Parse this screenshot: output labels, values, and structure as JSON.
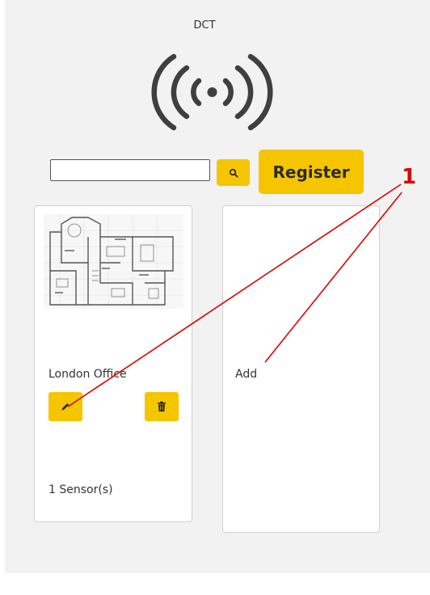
{
  "app": {
    "title": "DCT",
    "logo_icon": "wireless-broadcast-icon"
  },
  "search": {
    "value": "",
    "placeholder": "",
    "button_icon": "search-icon"
  },
  "toolbar": {
    "register_label": "Register"
  },
  "cards": [
    {
      "title": "London Office",
      "image": "floor-plan-image",
      "edit_icon": "pencil-icon",
      "delete_icon": "trash-icon",
      "sensor_count": "1 Sensor(s)"
    },
    {
      "title": "Add"
    }
  ],
  "annotation": {
    "number": "1",
    "color": "#e00000"
  },
  "colors": {
    "accent": "#f5c600",
    "background": "#f2f2f2",
    "text": "#333333"
  }
}
